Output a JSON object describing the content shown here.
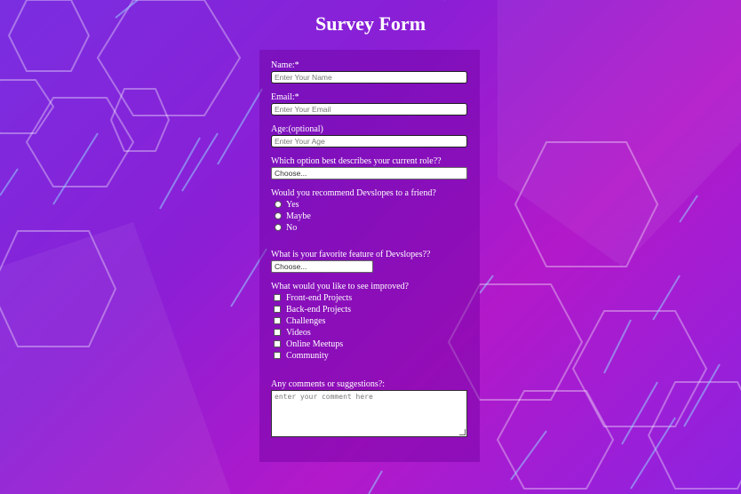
{
  "page": {
    "title": "Survey Form"
  },
  "form": {
    "name": {
      "label": "Name:*",
      "placeholder": "Enter Your Name"
    },
    "email": {
      "label": "Email:*",
      "placeholder": "Enter Your Email"
    },
    "age": {
      "label": "Age:(optional)",
      "placeholder": "Enter Your Age"
    },
    "role": {
      "label": "Which option best describes your current role??",
      "selected": "Choose..."
    },
    "recommend": {
      "label": "Would you recommend Devslopes to a friend?",
      "options": [
        "Yes",
        "Maybe",
        "No"
      ]
    },
    "favorite": {
      "label": "What is your favorite feature of Devslopes??",
      "selected": "Choose..."
    },
    "improve": {
      "label": "What would you like to see improved?",
      "options": [
        "Front-end Projects",
        "Back-end Projects",
        "Challenges",
        "Videos",
        "Online Meetups",
        "Community"
      ]
    },
    "comments": {
      "label": "Any comments or suggestions?:",
      "placeholder": "enter your comment here"
    }
  },
  "colors": {
    "background_start": "#7a2ee0",
    "background_mid": "#b219c9",
    "panel": "#6e00a0",
    "text": "#ffffff"
  }
}
